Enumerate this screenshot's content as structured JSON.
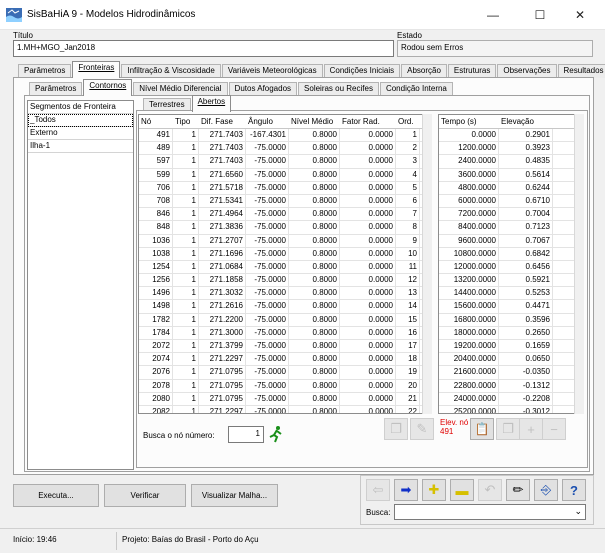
{
  "window": {
    "title": "SisBaHiA 9 - Modelos Hidrodinâmicos",
    "minimize": "—",
    "maximize": "☐",
    "close": "✕"
  },
  "titulo": {
    "label": "Título",
    "value": "1.MH+MGO_Jan2018"
  },
  "estado": {
    "label": "Estado",
    "value": "Rodou sem Erros"
  },
  "main_tabs": [
    "Parâmetros",
    "Fronteiras",
    "Infiltração & Viscosidade",
    "Variáveis Meteorológicas",
    "Condições Iniciais",
    "Absorção",
    "Estruturas",
    "Observações",
    "Resultados"
  ],
  "sub_tabs": [
    "Parâmetros",
    "Contornos",
    "Nível Médio Diferencial",
    "Dutos Afogados",
    "Soleiras ou Recifes",
    "Condição Interna"
  ],
  "sub_sub_tabs": [
    "Terrestres",
    "Abertos"
  ],
  "segments": {
    "header": "Segmentos de Fronteira",
    "items": [
      "_Todos",
      "Externo",
      "Ilha-1"
    ]
  },
  "nodes_table": {
    "columns": [
      "Nó",
      "Tipo",
      "Dif. Fase",
      "Ângulo",
      "Nível Médio",
      "Fator Rad.",
      "Ord."
    ],
    "rows": [
      [
        "491",
        "1",
        "271.7403",
        "-167.4301",
        "0.8000",
        "0.0000",
        "1"
      ],
      [
        "489",
        "1",
        "271.7403",
        "-75.0000",
        "0.8000",
        "0.0000",
        "2"
      ],
      [
        "597",
        "1",
        "271.7403",
        "-75.0000",
        "0.8000",
        "0.0000",
        "3"
      ],
      [
        "599",
        "1",
        "271.6560",
        "-75.0000",
        "0.8000",
        "0.0000",
        "4"
      ],
      [
        "706",
        "1",
        "271.5718",
        "-75.0000",
        "0.8000",
        "0.0000",
        "5"
      ],
      [
        "708",
        "1",
        "271.5341",
        "-75.0000",
        "0.8000",
        "0.0000",
        "6"
      ],
      [
        "846",
        "1",
        "271.4964",
        "-75.0000",
        "0.8000",
        "0.0000",
        "7"
      ],
      [
        "848",
        "1",
        "271.3836",
        "-75.0000",
        "0.8000",
        "0.0000",
        "8"
      ],
      [
        "1036",
        "1",
        "271.2707",
        "-75.0000",
        "0.8000",
        "0.0000",
        "9"
      ],
      [
        "1038",
        "1",
        "271.1696",
        "-75.0000",
        "0.8000",
        "0.0000",
        "10"
      ],
      [
        "1254",
        "1",
        "271.0684",
        "-75.0000",
        "0.8000",
        "0.0000",
        "11"
      ],
      [
        "1256",
        "1",
        "271.1858",
        "-75.0000",
        "0.8000",
        "0.0000",
        "12"
      ],
      [
        "1496",
        "1",
        "271.3032",
        "-75.0000",
        "0.8000",
        "0.0000",
        "13"
      ],
      [
        "1498",
        "1",
        "271.2616",
        "-75.0000",
        "0.8000",
        "0.0000",
        "14"
      ],
      [
        "1782",
        "1",
        "271.2200",
        "-75.0000",
        "0.8000",
        "0.0000",
        "15"
      ],
      [
        "1784",
        "1",
        "271.3000",
        "-75.0000",
        "0.8000",
        "0.0000",
        "16"
      ],
      [
        "2072",
        "1",
        "271.3799",
        "-75.0000",
        "0.8000",
        "0.0000",
        "17"
      ],
      [
        "2074",
        "1",
        "271.2297",
        "-75.0000",
        "0.8000",
        "0.0000",
        "18"
      ],
      [
        "2076",
        "1",
        "271.0795",
        "-75.0000",
        "0.8000",
        "0.0000",
        "19"
      ],
      [
        "2078",
        "1",
        "271.0795",
        "-75.0000",
        "0.8000",
        "0.0000",
        "20"
      ],
      [
        "2080",
        "1",
        "271.0795",
        "-75.0000",
        "0.8000",
        "0.0000",
        "21"
      ],
      [
        "2082",
        "1",
        "271.2297",
        "-75.0000",
        "0.8000",
        "0.0000",
        "22"
      ]
    ]
  },
  "elev_table": {
    "columns": [
      "Tempo (s)",
      "Elevação"
    ],
    "rows": [
      [
        "0.0000",
        "0.2901"
      ],
      [
        "1200.0000",
        "0.3923"
      ],
      [
        "2400.0000",
        "0.4835"
      ],
      [
        "3600.0000",
        "0.5614"
      ],
      [
        "4800.0000",
        "0.6244"
      ],
      [
        "6000.0000",
        "0.6710"
      ],
      [
        "7200.0000",
        "0.7004"
      ],
      [
        "8400.0000",
        "0.7123"
      ],
      [
        "9600.0000",
        "0.7067"
      ],
      [
        "10800.0000",
        "0.6842"
      ],
      [
        "12000.0000",
        "0.6456"
      ],
      [
        "13200.0000",
        "0.5921"
      ],
      [
        "14400.0000",
        "0.5253"
      ],
      [
        "15600.0000",
        "0.4471"
      ],
      [
        "16800.0000",
        "0.3596"
      ],
      [
        "18000.0000",
        "0.2650"
      ],
      [
        "19200.0000",
        "0.1659"
      ],
      [
        "20400.0000",
        "0.0650"
      ],
      [
        "21600.0000",
        "-0.0350"
      ],
      [
        "22800.0000",
        "-0.1312"
      ],
      [
        "24000.0000",
        "-0.2208"
      ],
      [
        "25200.0000",
        "-0.3012"
      ]
    ]
  },
  "search_node": {
    "label": "Busca o nó número:",
    "value": "1"
  },
  "elev_note": {
    "line1": "Elev. nó",
    "line2": "491"
  },
  "buttons": {
    "executa": "Executa...",
    "verificar": "Verificar",
    "visualizar": "Visualizar Malha..."
  },
  "toolbar": {
    "busca_label": "Busca:",
    "busca_value": ""
  },
  "status": {
    "inicio": "Início: 19:46",
    "projeto": "Projeto: Baías do Brasil - Porto do Açu"
  },
  "colors": {
    "arrow_blue": "#1030c8",
    "plus_yellow": "#d6c000",
    "exit_blue": "#1a4fb0",
    "help_blue": "#1a4fb0",
    "red_note": "#e00000",
    "green_runner": "#1a8f1a"
  }
}
